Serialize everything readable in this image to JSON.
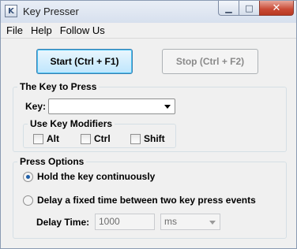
{
  "window": {
    "title": "Key Presser",
    "app_icon_glyph": "K",
    "minimize_glyph": "▁",
    "maximize_glyph": "□",
    "close_glyph": "✕"
  },
  "menu": {
    "items": [
      "File",
      "Help",
      "Follow Us"
    ]
  },
  "toolbar": {
    "start_label": "Start (Ctrl + F1)",
    "stop_label": "Stop (Ctrl + F2)"
  },
  "key_group": {
    "legend": "The Key to Press",
    "key_label": "Key:",
    "key_value": "",
    "modifiers_legend": "Use Key Modifiers",
    "modifiers": [
      {
        "label": "Alt",
        "checked": false
      },
      {
        "label": "Ctrl",
        "checked": false
      },
      {
        "label": "Shift",
        "checked": false
      }
    ]
  },
  "press_options": {
    "legend": "Press Options",
    "options": [
      {
        "label": "Hold the key continuously",
        "selected": true
      },
      {
        "label": "Delay a fixed time between two key press events",
        "selected": false
      }
    ],
    "delay_label": "Delay Time:",
    "delay_value": "1000",
    "delay_unit": "ms"
  }
}
